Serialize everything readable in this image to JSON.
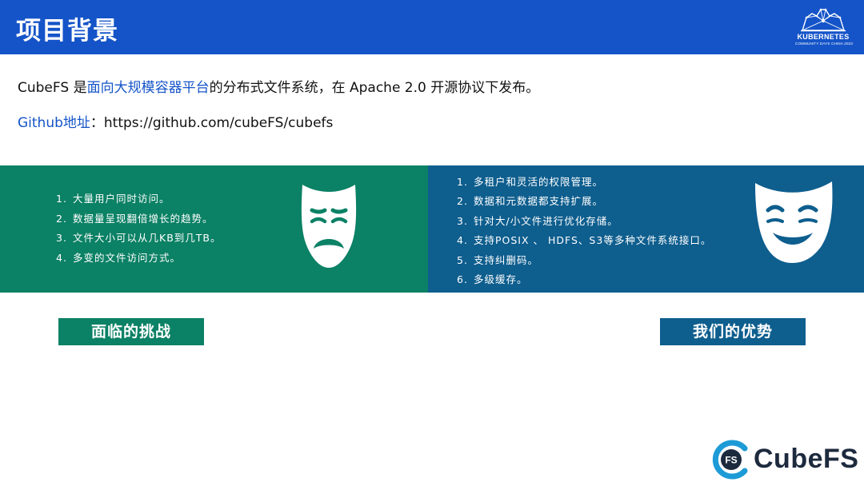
{
  "header": {
    "title": "项目背景",
    "logo": {
      "name": "KUBERNETES",
      "sub": "COMMUNITY DAYS CHINA 2023",
      "icon": "kubernetes-community-logo"
    }
  },
  "intro": {
    "part1": "CubeFS 是",
    "highlight": "面向大规模容器平台",
    "part2": "的分布式文件系统，在 Apache 2.0 开源协议下发布。"
  },
  "github": {
    "label": "Github地址",
    "separator": "：",
    "url": "https://github.com/cubeFS/cubefs"
  },
  "challenges": {
    "label": "面临的挑战",
    "icon": "sad-mask-icon",
    "items": [
      {
        "num": "1.",
        "text": "大量用户同时访问。"
      },
      {
        "num": "2.",
        "text": "数据量呈现翻倍增长的趋势。"
      },
      {
        "num": "3.",
        "text": "文件大小可以从几KB到几TB。"
      },
      {
        "num": "4.",
        "text": "多变的文件访问方式。"
      }
    ]
  },
  "advantages": {
    "label": "我们的优势",
    "icon": "happy-mask-icon",
    "items": [
      {
        "num": "1.",
        "text": "多租户和灵活的权限管理。"
      },
      {
        "num": "2.",
        "text": "数据和元数据都支持扩展。"
      },
      {
        "num": "3.",
        "text": "针对大/小文件进行优化存储。"
      },
      {
        "num": "4.",
        "text": "支持POSIX 、 HDFS、S3等多种文件系统接口。"
      },
      {
        "num": "5.",
        "text": "支持纠删码。"
      },
      {
        "num": "6.",
        "text": "多级缓存。"
      }
    ]
  },
  "footer": {
    "brand": "CubeFS",
    "badge": "FS",
    "icon": "cubefs-logo"
  },
  "colors": {
    "header_blue": "#1554c8",
    "green": "#0b8165",
    "blue": "#0e5e8e",
    "link_blue": "#1554c8"
  }
}
